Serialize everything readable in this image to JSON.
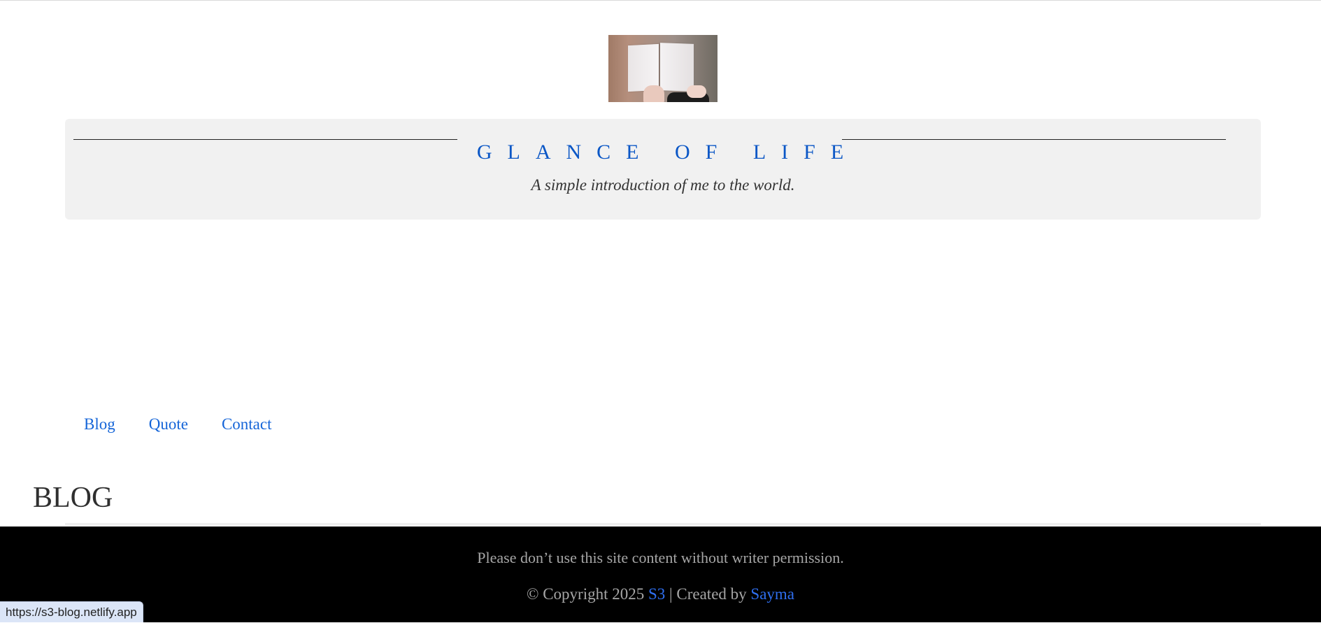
{
  "header": {
    "title": "GLANCE OF LIFE",
    "tagline": "A simple introduction of me to the world."
  },
  "nav": {
    "items": [
      {
        "label": "Blog"
      },
      {
        "label": "Quote"
      },
      {
        "label": "Contact"
      }
    ]
  },
  "main": {
    "section_heading": "BLOG"
  },
  "footer": {
    "notice": "Please don’t use this site content without writer permission.",
    "copyright_prefix": "© Copyright 2025",
    "brand_link": "S3",
    "created_by_text": "| Created by",
    "author_link": "Sayma"
  },
  "status_bar": {
    "url": "https://s3-blog.netlify.app"
  },
  "colors": {
    "accent": "#0b57c6",
    "link": "#1565d8",
    "footer_bg": "#000000",
    "header_bg": "#f1f1f1"
  },
  "icons": {
    "logo": "open-book-logo"
  }
}
